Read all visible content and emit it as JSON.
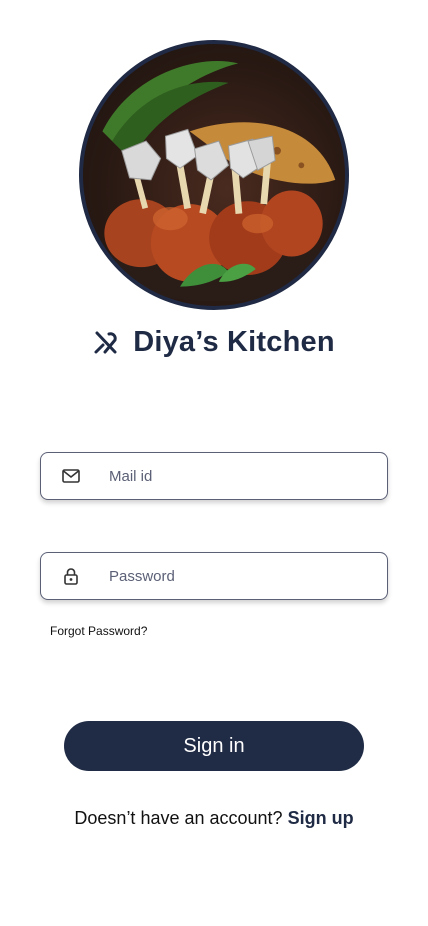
{
  "hero": {
    "image_name": "chicken-lollipop-photo",
    "border_color": "#202a44"
  },
  "brand": {
    "icon": "utensils-icon",
    "title": "Diya’s Kitchen"
  },
  "form": {
    "email": {
      "icon": "mail-icon",
      "placeholder": "Mail id",
      "value": ""
    },
    "password": {
      "icon": "lock-icon",
      "placeholder": "Password",
      "value": ""
    },
    "forgot_label": "Forgot Password?"
  },
  "actions": {
    "signin_label": "Sign in"
  },
  "footer": {
    "prompt": "Doesn’t have an account?",
    "signup_label": "Sign up"
  },
  "colors": {
    "primary": "#202b45",
    "field_border": "#5b6076",
    "background": "#ffffff"
  }
}
